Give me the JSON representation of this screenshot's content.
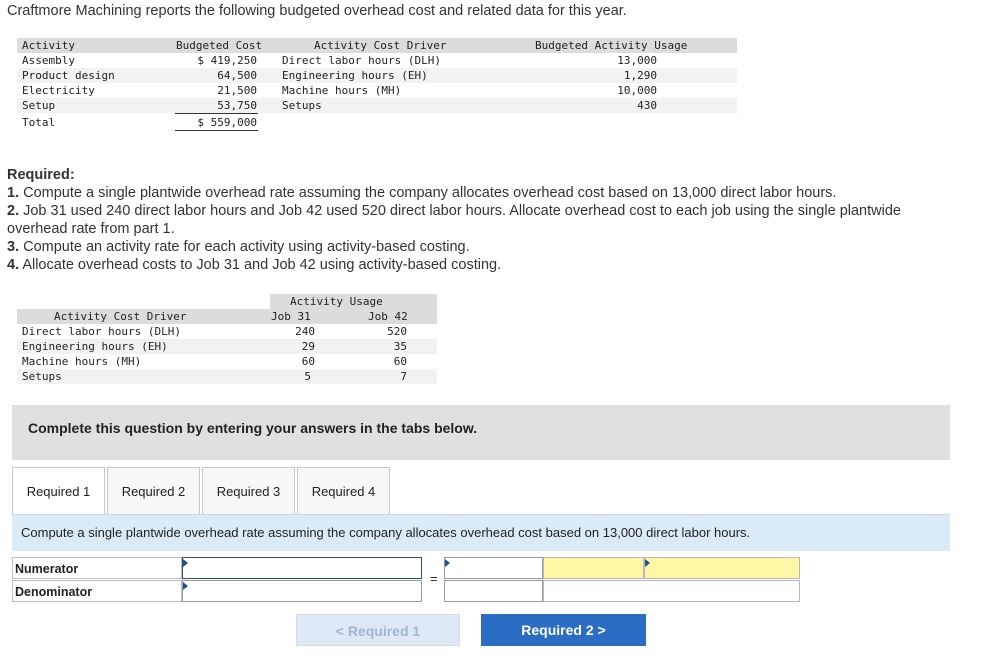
{
  "intro": "Craftmore Machining reports the following budgeted overhead cost and related data for this year.",
  "cost_table": {
    "headers": [
      "Activity",
      "Budgeted Cost",
      "Activity Cost Driver",
      "Budgeted Activity Usage"
    ],
    "rows": [
      {
        "activity": "Assembly",
        "cost": "$ 419,250",
        "driver": "Direct labor hours (DLH)",
        "usage": "13,000"
      },
      {
        "activity": "Product design",
        "cost": "64,500",
        "driver": "Engineering hours (EH)",
        "usage": "1,290"
      },
      {
        "activity": "Electricity",
        "cost": "21,500",
        "driver": "Machine hours (MH)",
        "usage": "10,000"
      },
      {
        "activity": "Setup",
        "cost": "53,750",
        "driver": "Setups",
        "usage": "430"
      }
    ],
    "total_label": "Total",
    "total_value": "$ 559,000"
  },
  "required": {
    "title": "Required:",
    "items": [
      {
        "num": "1.",
        "text": " Compute a single plantwide overhead rate assuming the company allocates overhead cost based on 13,000 direct labor hours."
      },
      {
        "num": "2.",
        "text": " Job 31 used 240 direct labor hours and Job 42 used 520 direct labor hours. Allocate overhead cost to each job using the single plantwide overhead rate from part 1."
      },
      {
        "num": "3.",
        "text": " Compute an activity rate for each activity using activity-based costing."
      },
      {
        "num": "4.",
        "text": " Allocate overhead costs to Job 31 and Job 42 using activity-based costing."
      }
    ]
  },
  "usage_table": {
    "group_header": "Activity Usage",
    "driver_header": "Activity Cost Driver",
    "job_headers": [
      "Job 31",
      "Job 42"
    ],
    "rows": [
      {
        "driver": "Direct labor hours (DLH)",
        "job31": "240",
        "job42": "520"
      },
      {
        "driver": "Engineering hours (EH)",
        "job31": "29",
        "job42": "35"
      },
      {
        "driver": "Machine hours (MH)",
        "job31": "60",
        "job42": "60"
      },
      {
        "driver": "Setups",
        "job31": "5",
        "job42": "7"
      }
    ]
  },
  "banner": "Complete this question by entering your answers in the tabs below.",
  "tabs": [
    "Required 1",
    "Required 2",
    "Required 3",
    "Required 4"
  ],
  "active_tab": "Required 1",
  "panel_instruction": "Compute a single plantwide overhead rate assuming the company allocates overhead cost based on 13,000 direct labor hours.",
  "form": {
    "numerator_label": "Numerator",
    "denominator_label": "Denominator",
    "equals": "="
  },
  "nav": {
    "prev_label": "< Required 1",
    "next_label": "Required 2 >"
  },
  "colors": {
    "next_button": "#2b6cc4",
    "answer_cell": "#fff7a6",
    "panel": "#dbeaf7"
  }
}
